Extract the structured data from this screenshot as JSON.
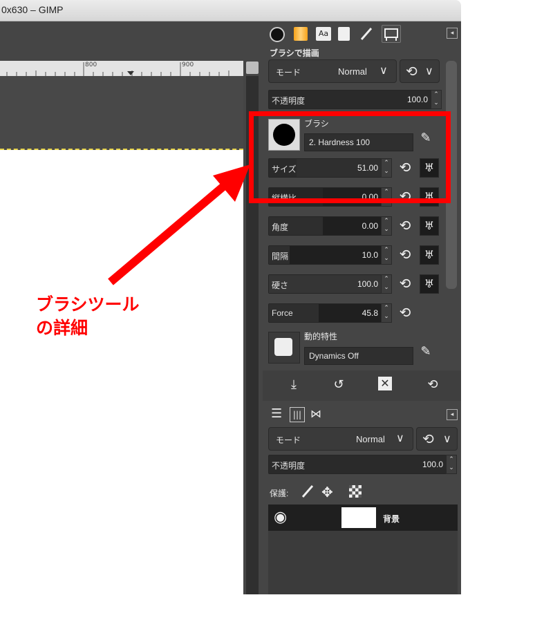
{
  "window": {
    "title": "0x630 – GIMP"
  },
  "ruler": {
    "ticks": [
      "800",
      "900"
    ]
  },
  "tool_options": {
    "header": "ブラシで描画",
    "mode_label": "モード",
    "mode_value": "Normal",
    "opacity_label": "不透明度",
    "opacity_value": "100.0",
    "brush_label": "ブラシ",
    "brush_name": "2. Hardness 100",
    "params": [
      {
        "label": "サイズ",
        "value": "51.00",
        "fill": 0.1
      },
      {
        "label": "縦横比",
        "value": "0.00",
        "fill": 0.5
      },
      {
        "label": "角度",
        "value": "0.00",
        "fill": 0.5
      },
      {
        "label": "間隔",
        "value": "10.0",
        "fill": 0.1
      },
      {
        "label": "硬さ",
        "value": "100.0",
        "fill": 1.0
      },
      {
        "label": "Force",
        "value": "45.8",
        "fill": 0.45
      }
    ],
    "dynamics_label": "動的特性",
    "dynamics_value": "Dynamics Off"
  },
  "layers": {
    "mode_label": "モード",
    "mode_value": "Normal",
    "opacity_label": "不透明度",
    "opacity_value": "100.0",
    "lock_label": "保護:",
    "layer_name": "背景"
  },
  "annotation": {
    "line1": "ブラシツール",
    "line2": "の詳細"
  },
  "colors": {
    "highlight": "#ff0000",
    "annotation_text": "#ff0000"
  }
}
